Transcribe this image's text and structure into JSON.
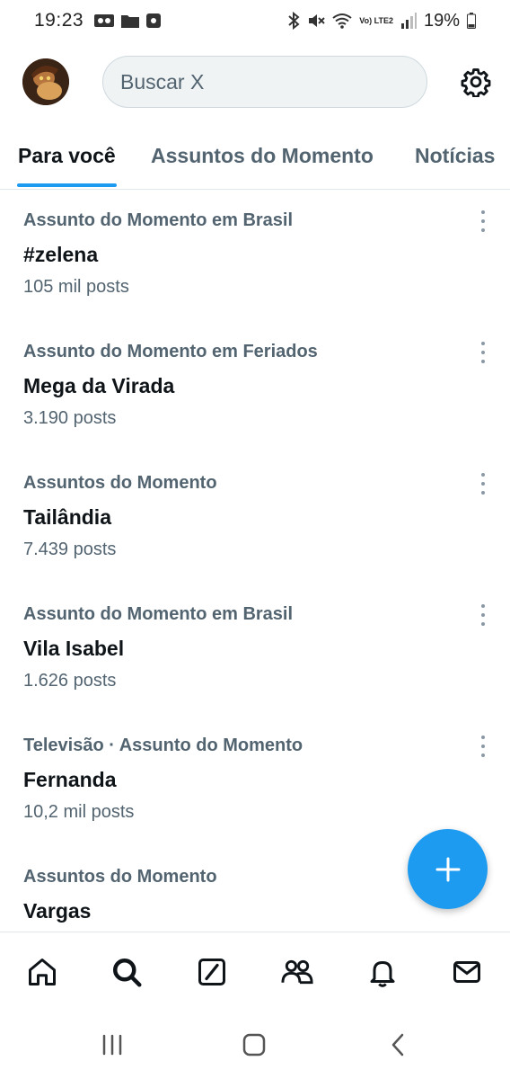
{
  "status_bar": {
    "time": "19:23",
    "network_label": "Vo) LTE2",
    "battery": "19%"
  },
  "header": {
    "search_placeholder": "Buscar X"
  },
  "tabs": [
    {
      "label": "Para você",
      "active": true
    },
    {
      "label": "Assuntos do Momento",
      "active": false
    },
    {
      "label": "Notícias",
      "active": false
    }
  ],
  "trends": [
    {
      "context": "Assunto do Momento em Brasil",
      "name": "#zelena",
      "posts": "105 mil posts"
    },
    {
      "context": "Assunto do Momento em Feriados",
      "name": "Mega da Virada",
      "posts": "3.190 posts"
    },
    {
      "context": "Assuntos do Momento",
      "name": "Tailândia",
      "posts": "7.439 posts"
    },
    {
      "context": "Assunto do Momento em Brasil",
      "name": "Vila Isabel",
      "posts": "1.626 posts"
    },
    {
      "context": "Televisão · Assunto do Momento",
      "name": "Fernanda",
      "posts": "10,2 mil posts"
    },
    {
      "context": "Assuntos do Momento",
      "name": "Vargas",
      "posts": ""
    }
  ],
  "bottom_nav": [
    "home-icon",
    "search-icon",
    "grok-icon",
    "communities-icon",
    "notifications-icon",
    "messages-icon"
  ],
  "colors": {
    "accent": "#1d9bf0",
    "text_primary": "#0f1419",
    "text_secondary": "#536471"
  }
}
